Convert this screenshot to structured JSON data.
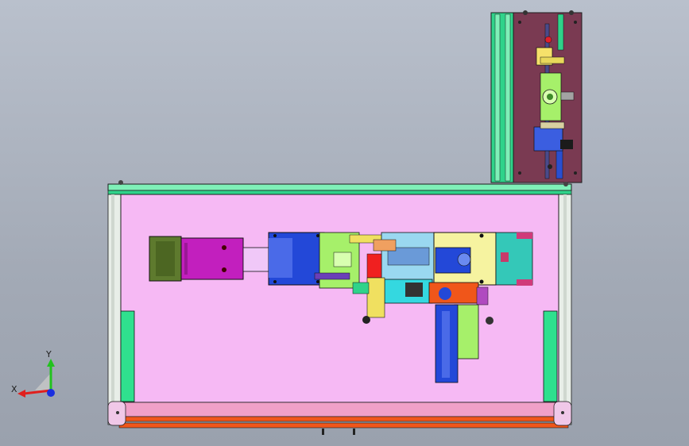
{
  "triad": {
    "x_label": "X",
    "y_label": "Y",
    "x_color": "#e0201e",
    "y_color": "#22c21e",
    "z_color": "#1a2fe0"
  },
  "colors": {
    "background_top": "#b9c0cc",
    "frame_green": "#2fd38a",
    "panel_pink": "#f6b9f4",
    "plate_maroon": "#7a3a52",
    "motor_magenta": "#c21fbe",
    "motor_olive": "#5e7a2e",
    "rail_orange": "#f0561a",
    "block_yellow": "#f6f3a0",
    "block_blue": "#2348d8",
    "block_cyan": "#34d8e0"
  },
  "components": [
    "main-frame",
    "upper-fixture-plate",
    "servo-motor",
    "linear-module",
    "gripper-assembly",
    "vertical-slide",
    "front-rail"
  ]
}
